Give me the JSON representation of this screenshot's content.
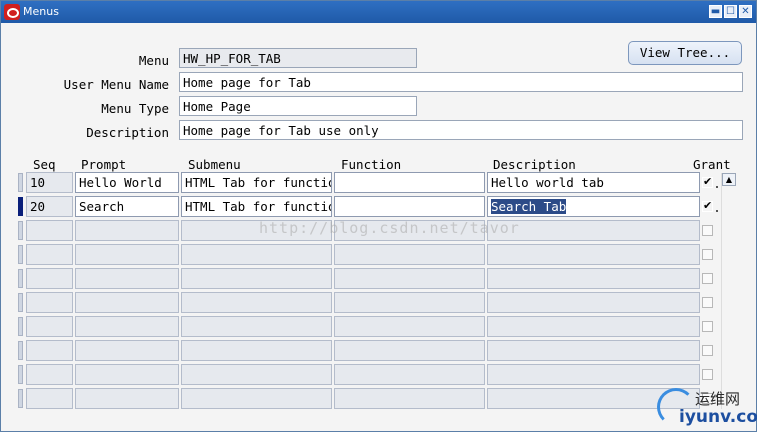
{
  "window": {
    "title": "Menus",
    "controls": {
      "minimize": "▬",
      "maximize": "☐",
      "close": "✕"
    }
  },
  "header_form": {
    "menu": {
      "label": "Menu",
      "value": "HW_HP_FOR_TAB"
    },
    "user_menu_name": {
      "label": "User Menu Name",
      "value": "Home page for Tab"
    },
    "menu_type": {
      "label": "Menu Type",
      "value": "Home Page"
    },
    "description": {
      "label": "Description",
      "value": "Home page for Tab use only"
    },
    "view_tree_label": "View Tree..."
  },
  "grid": {
    "columns": {
      "seq": "Seq",
      "prompt": "Prompt",
      "submenu": "Submenu",
      "function": "Function",
      "description": "Description",
      "grant": "Grant"
    },
    "rows": [
      {
        "seq": "10",
        "prompt": "Hello World",
        "submenu": "HTML Tab for function",
        "function": "",
        "description": "Hello world tab",
        "grant": true
      },
      {
        "seq": "20",
        "prompt": "Search",
        "submenu": "HTML Tab for function",
        "function": "",
        "description": "Search Tab",
        "grant": true
      }
    ],
    "empty_rows": 8,
    "active_row_index": 1
  },
  "watermark": "http://blog.csdn.net/tavor",
  "site_logo": {
    "cn": "运维网",
    "en": "iyunv.com"
  },
  "colors": {
    "titlebar": "#1f5aa8",
    "selection": "#2c4b88",
    "active_row_marker": "#0a1f7a"
  }
}
